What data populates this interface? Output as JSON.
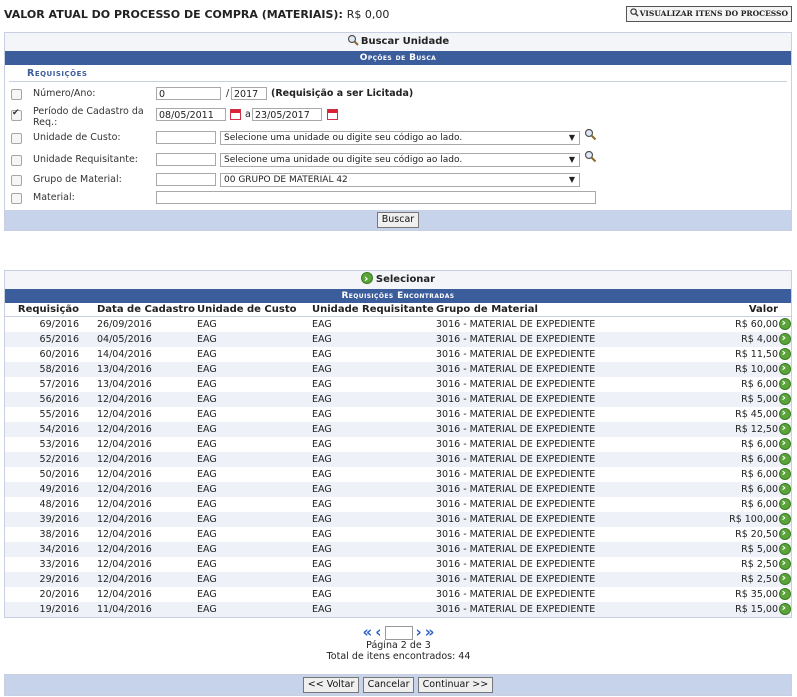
{
  "header": {
    "label": "VALOR ATUAL DO PROCESSO DE COMPRA (MATERIAIS):",
    "value": "R$ 0,00",
    "view_items_button": "VISUALIZAR ITENS DO PROCESSO"
  },
  "search_unit_link": "Buscar Unidade",
  "search_options": {
    "title": "Opções de Busca",
    "section": "Requisições",
    "fields": {
      "numero_label": "Número/Ano:",
      "numero_value": "0",
      "ano_value": "2017",
      "licitada_note": "(Requisição a ser Licitada)",
      "periodo_label": "Período de Cadastro da Req.:",
      "periodo_from": "08/05/2011",
      "periodo_sep": "a",
      "periodo_to": "23/05/2017",
      "custo_label": "Unidade de Custo:",
      "custo_select": "Selecione uma unidade ou digite seu código ao lado.",
      "requisitante_label": "Unidade Requisitante:",
      "requisitante_select": "Selecione uma unidade ou digite seu código ao lado.",
      "grupo_label": "Grupo de Material:",
      "grupo_select": "00 GRUPO DE MATERIAL 42",
      "material_label": "Material:"
    },
    "checks": {
      "numero": false,
      "periodo": true,
      "custo": false,
      "requisitante": false,
      "grupo": false,
      "material": false
    },
    "search_button": "Buscar"
  },
  "select_link": "Selecionar",
  "results": {
    "title": "Requisições Encontradas",
    "columns": [
      "Requisição",
      "Data de Cadastro",
      "Unidade de Custo",
      "Unidade Requisitante",
      "Grupo de Material",
      "Valor"
    ],
    "rows": [
      [
        "69/2016",
        "26/09/2016",
        "EAG",
        "EAG",
        "3016 - MATERIAL DE EXPEDIENTE",
        "R$ 60,00"
      ],
      [
        "65/2016",
        "04/05/2016",
        "EAG",
        "EAG",
        "3016 - MATERIAL DE EXPEDIENTE",
        "R$ 4,00"
      ],
      [
        "60/2016",
        "14/04/2016",
        "EAG",
        "EAG",
        "3016 - MATERIAL DE EXPEDIENTE",
        "R$ 11,50"
      ],
      [
        "58/2016",
        "13/04/2016",
        "EAG",
        "EAG",
        "3016 - MATERIAL DE EXPEDIENTE",
        "R$ 10,00"
      ],
      [
        "57/2016",
        "13/04/2016",
        "EAG",
        "EAG",
        "3016 - MATERIAL DE EXPEDIENTE",
        "R$ 6,00"
      ],
      [
        "56/2016",
        "12/04/2016",
        "EAG",
        "EAG",
        "3016 - MATERIAL DE EXPEDIENTE",
        "R$ 5,00"
      ],
      [
        "55/2016",
        "12/04/2016",
        "EAG",
        "EAG",
        "3016 - MATERIAL DE EXPEDIENTE",
        "R$ 45,00"
      ],
      [
        "54/2016",
        "12/04/2016",
        "EAG",
        "EAG",
        "3016 - MATERIAL DE EXPEDIENTE",
        "R$ 12,50"
      ],
      [
        "53/2016",
        "12/04/2016",
        "EAG",
        "EAG",
        "3016 - MATERIAL DE EXPEDIENTE",
        "R$ 6,00"
      ],
      [
        "52/2016",
        "12/04/2016",
        "EAG",
        "EAG",
        "3016 - MATERIAL DE EXPEDIENTE",
        "R$ 6,00"
      ],
      [
        "50/2016",
        "12/04/2016",
        "EAG",
        "EAG",
        "3016 - MATERIAL DE EXPEDIENTE",
        "R$ 6,00"
      ],
      [
        "49/2016",
        "12/04/2016",
        "EAG",
        "EAG",
        "3016 - MATERIAL DE EXPEDIENTE",
        "R$ 6,00"
      ],
      [
        "48/2016",
        "12/04/2016",
        "EAG",
        "EAG",
        "3016 - MATERIAL DE EXPEDIENTE",
        "R$ 6,00"
      ],
      [
        "39/2016",
        "12/04/2016",
        "EAG",
        "EAG",
        "3016 - MATERIAL DE EXPEDIENTE",
        "R$ 100,00"
      ],
      [
        "38/2016",
        "12/04/2016",
        "EAG",
        "EAG",
        "3016 - MATERIAL DE EXPEDIENTE",
        "R$ 20,50"
      ],
      [
        "34/2016",
        "12/04/2016",
        "EAG",
        "EAG",
        "3016 - MATERIAL DE EXPEDIENTE",
        "R$ 5,00"
      ],
      [
        "33/2016",
        "12/04/2016",
        "EAG",
        "EAG",
        "3016 - MATERIAL DE EXPEDIENTE",
        "R$ 2,50"
      ],
      [
        "29/2016",
        "12/04/2016",
        "EAG",
        "EAG",
        "3016 - MATERIAL DE EXPEDIENTE",
        "R$ 2,50"
      ],
      [
        "20/2016",
        "12/04/2016",
        "EAG",
        "EAG",
        "3016 - MATERIAL DE EXPEDIENTE",
        "R$ 35,00"
      ],
      [
        "19/2016",
        "11/04/2016",
        "EAG",
        "EAG",
        "3016 - MATERIAL DE EXPEDIENTE",
        "R$ 15,00"
      ]
    ]
  },
  "pagination": {
    "page_text": "Página 2 de 3",
    "total_text": "Total de itens encontrados: 44"
  },
  "footer": {
    "back": "<< Voltar",
    "cancel": "Cancelar",
    "continue": "Continuar >>"
  },
  "colors": {
    "bar": "#3c5d9c",
    "footer_bar": "#c7d3ea",
    "row_alt": "#eef1f7",
    "accent_green": "#5aa43a"
  }
}
